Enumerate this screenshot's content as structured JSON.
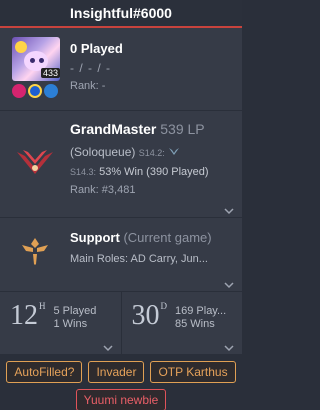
{
  "header": {
    "title": "Insightful#6000"
  },
  "profile": {
    "level": "433",
    "played": "0 Played",
    "kda": "- / - / -",
    "rank": "Rank: -"
  },
  "ranked": {
    "tier": "GrandMaster",
    "lp": "539 LP",
    "queue": "(Soloqueue)",
    "prev_season": "S14.2:",
    "season": "S14.3:",
    "winrate": "53% Win (390 Played)",
    "rank": "Rank: #3,481"
  },
  "role": {
    "name": "Support",
    "current": "(Current game)",
    "mains": "Main Roles: AD Carry, Jun..."
  },
  "stats": [
    {
      "value": "12",
      "unit": "H",
      "line1": "5 Played",
      "line2": "1 Wins"
    },
    {
      "value": "30",
      "unit": "D",
      "line1": "169 Play...",
      "line2": "85 Wins"
    }
  ],
  "tags": [
    {
      "label": "AutoFilled?",
      "color": "#e6a25a"
    },
    {
      "label": "Invader",
      "color": "#e6a25a"
    },
    {
      "label": "OTP Karthus",
      "color": "#e6a25a"
    },
    {
      "label": "Yuumi newbie",
      "color": "#ea5f67"
    }
  ],
  "icons": {
    "crest": "grandmaster-crest-icon",
    "role": "support-role-icon",
    "chevron": "chevron-down-icon"
  }
}
